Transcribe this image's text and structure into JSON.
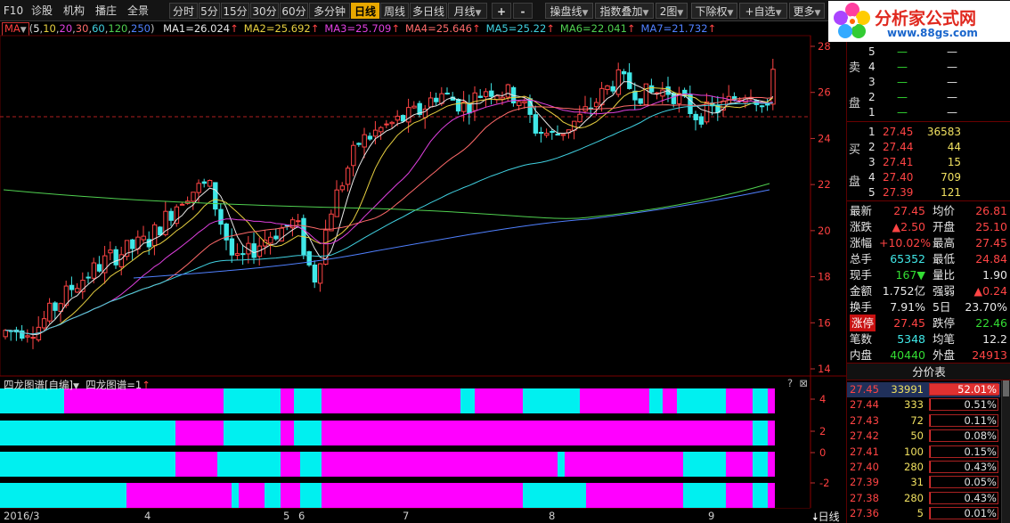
{
  "toolbar": {
    "f10": "F10",
    "menu": [
      "诊股",
      "机构",
      "播庄",
      "全景"
    ],
    "periods": [
      "分时",
      "5分",
      "15分",
      "30分",
      "60分",
      "多分钟",
      "日线",
      "周线",
      "多日线",
      "月线"
    ],
    "active_period": "日线",
    "plus": "+",
    "minus": "-",
    "tools": [
      "操盘线",
      "指数叠加",
      "2图",
      "下除权",
      "+自选",
      "更多"
    ]
  },
  "logo": {
    "title": "分析家公式网",
    "url": "www.88gs.com"
  },
  "ma_legend": {
    "button": "MA",
    "params": [
      "5",
      "10",
      "20",
      "30",
      "60",
      "120",
      "250"
    ],
    "items": [
      {
        "label": "MA1=26.024",
        "color": "#e8e8e8"
      },
      {
        "label": "MA2=25.692",
        "color": "#e8d040"
      },
      {
        "label": "MA3=25.709",
        "color": "#e040e0"
      },
      {
        "label": "MA4=25.646",
        "color": "#ff6a6a"
      },
      {
        "label": "MA5=25.22",
        "color": "#40d0e0"
      },
      {
        "label": "MA6=22.041",
        "color": "#50d050"
      },
      {
        "label": "MA7=21.732",
        "color": "#5080ff"
      }
    ],
    "arrow": "↑"
  },
  "price_axis": {
    "ticks": [
      "28",
      "26",
      "24",
      "22",
      "20",
      "18",
      "16",
      "14"
    ]
  },
  "indicator": {
    "name": "四龙图谱[自编]",
    "value_label": "四龙图谱=1",
    "arrow": "↑",
    "help": "?",
    "close": "⊠",
    "ticks": [
      "4",
      "2",
      "0",
      "-2"
    ]
  },
  "date_axis": [
    "2016/3",
    "4",
    "5",
    "6",
    "7",
    "8",
    "9"
  ],
  "period_label": "日线",
  "orderbook": {
    "sell_label": [
      "卖",
      "盘"
    ],
    "buy_label": [
      "买",
      "盘"
    ],
    "sells": [
      {
        "level": "5",
        "price": "—",
        "vol": "—"
      },
      {
        "level": "4",
        "price": "—",
        "vol": "—"
      },
      {
        "level": "3",
        "price": "—",
        "vol": "—"
      },
      {
        "level": "2",
        "price": "—",
        "vol": "—"
      },
      {
        "level": "1",
        "price": "—",
        "vol": "—"
      }
    ],
    "buys": [
      {
        "level": "1",
        "price": "27.45",
        "vol": "36583"
      },
      {
        "level": "2",
        "price": "27.44",
        "vol": "44"
      },
      {
        "level": "3",
        "price": "27.41",
        "vol": "15"
      },
      {
        "level": "4",
        "price": "27.40",
        "vol": "709"
      },
      {
        "level": "5",
        "price": "27.39",
        "vol": "121"
      }
    ]
  },
  "quotes": [
    {
      "k1": "最新",
      "v1": "27.45",
      "c1": "red",
      "k2": "均价",
      "v2": "26.81",
      "c2": "red"
    },
    {
      "k1": "涨跌",
      "v1": "▲2.50",
      "c1": "red",
      "k2": "开盘",
      "v2": "25.10",
      "c2": "red"
    },
    {
      "k1": "涨幅",
      "v1": "+10.02%",
      "c1": "red",
      "k2": "最高",
      "v2": "27.45",
      "c2": "red"
    },
    {
      "k1": "总手",
      "v1": "65352",
      "c1": "cyan",
      "k2": "最低",
      "v2": "24.84",
      "c2": "red"
    },
    {
      "k1": "现手",
      "v1": "167▼",
      "c1": "green",
      "k2": "量比",
      "v2": "1.90",
      "c2": "white"
    },
    {
      "k1": "金额",
      "v1": "1.752亿",
      "c1": "white",
      "k2": "强弱",
      "v2": "▲0.24",
      "c2": "red"
    },
    {
      "k1": "换手",
      "v1": "7.91%",
      "c1": "white",
      "k2": "5日",
      "v2": "23.70%",
      "c2": "white"
    },
    {
      "k1": "涨停",
      "v1": "27.45",
      "c1": "red",
      "k2": "跌停",
      "v2": "22.46",
      "c2": "green"
    },
    {
      "k1": "笔数",
      "v1": "5348",
      "c1": "cyan",
      "k2": "均笔",
      "v2": "12.2",
      "c2": "white"
    },
    {
      "k1": "内盘",
      "v1": "40440",
      "c1": "green",
      "k2": "外盘",
      "v2": "24913",
      "c2": "red"
    }
  ],
  "price_table": {
    "title": "分价表",
    "rows": [
      {
        "price": "27.45",
        "vol": "33991",
        "pct": "52.01%",
        "ratio": 0.5201
      },
      {
        "price": "27.44",
        "vol": "333",
        "pct": "0.51%",
        "ratio": 0.0051
      },
      {
        "price": "27.43",
        "vol": "72",
        "pct": "0.11%",
        "ratio": 0.0011
      },
      {
        "price": "27.42",
        "vol": "50",
        "pct": "0.08%",
        "ratio": 0.0008
      },
      {
        "price": "27.41",
        "vol": "100",
        "pct": "0.15%",
        "ratio": 0.0015
      },
      {
        "price": "27.40",
        "vol": "280",
        "pct": "0.43%",
        "ratio": 0.0043
      },
      {
        "price": "27.39",
        "vol": "31",
        "pct": "0.05%",
        "ratio": 0.0005
      },
      {
        "price": "27.38",
        "vol": "280",
        "pct": "0.43%",
        "ratio": 0.0043
      },
      {
        "price": "27.36",
        "vol": "5",
        "pct": "0.01%",
        "ratio": 0.0001
      }
    ]
  },
  "colors": {
    "up": "#ff4444",
    "down": "#40e8e8",
    "cyan_band": "#00f0f0",
    "magenta_band": "#ff00ff",
    "active": "#e8a800"
  }
}
